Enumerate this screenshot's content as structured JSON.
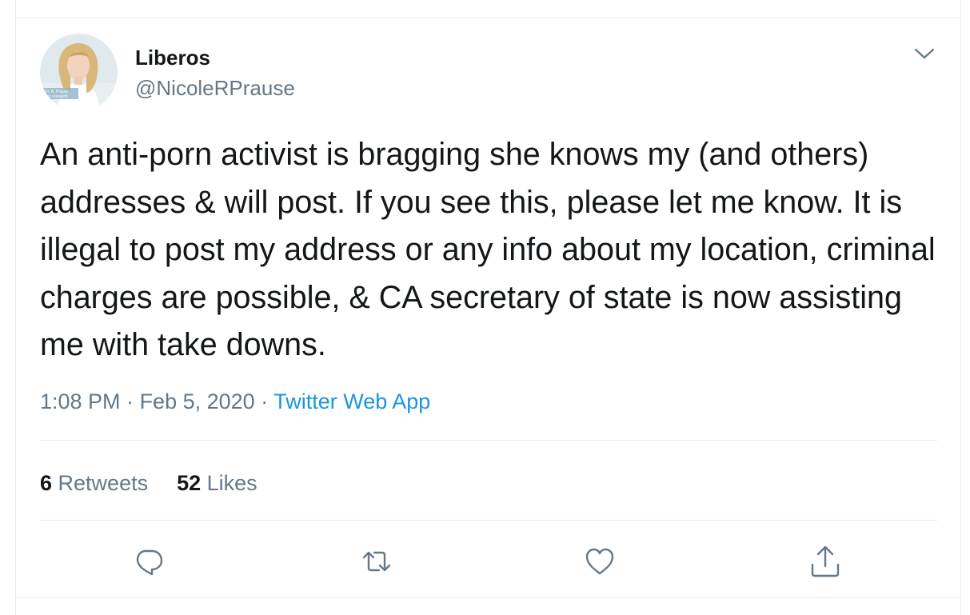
{
  "user": {
    "display_name": "Liberos",
    "handle": "@NicoleRPrause",
    "avatar_icon": "profile-photo"
  },
  "tweet": {
    "text": "An anti-porn activist is bragging she knows my (and others) addresses & will post. If you see this, please let me know. It is illegal to post my address or any info about my location, criminal charges are possible, & CA secretary of state is now assisting me with take downs."
  },
  "meta": {
    "time": "1:08 PM",
    "separator_1": " · ",
    "date": "Feb 5, 2020",
    "separator_2": " · ",
    "source": "Twitter Web App"
  },
  "stats": {
    "retweets_count": "6",
    "retweets_label": " Retweets",
    "likes_count": "52",
    "likes_label": " Likes"
  },
  "actions": {
    "reply_icon": "reply-icon",
    "retweet_icon": "retweet-icon",
    "like_icon": "heart-icon",
    "share_icon": "share-icon"
  },
  "colors": {
    "text_primary": "#14171a",
    "text_secondary": "#657786",
    "link": "#1b95e0",
    "divider": "#e6ecf0"
  }
}
